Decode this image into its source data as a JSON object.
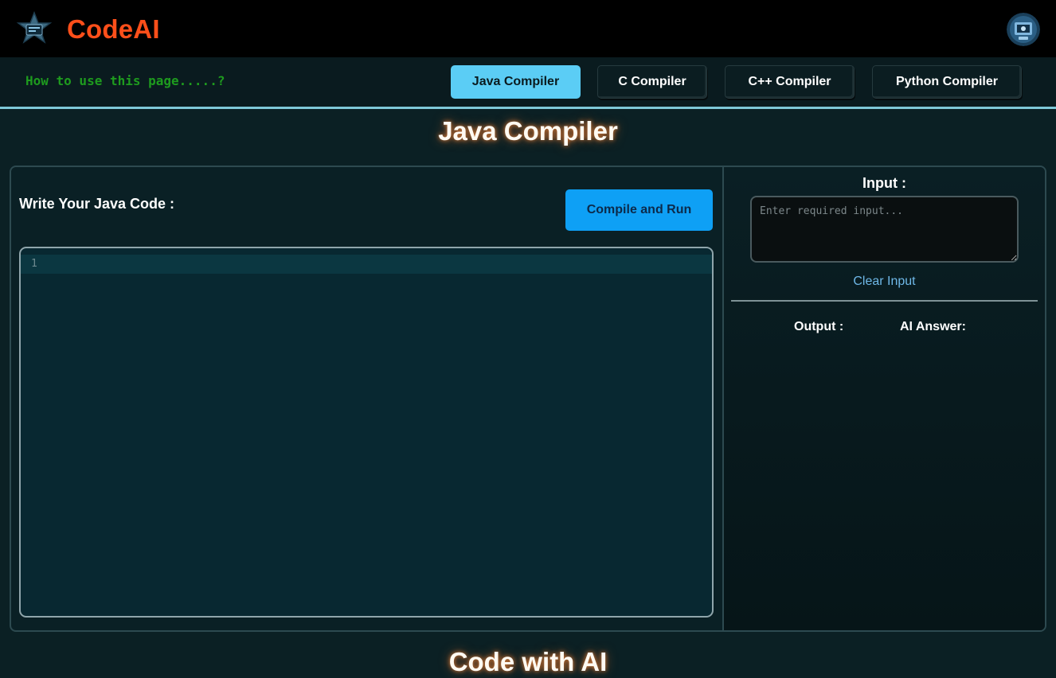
{
  "app": {
    "brand": "CodeAI",
    "brand_color": "#ff4f1a"
  },
  "header": {
    "logo_icon": "star-code-logo-icon",
    "avatar_icon": "user-avatar-icon"
  },
  "nav": {
    "help_link": "How to use this page.....?",
    "tabs": [
      {
        "label": "Java Compiler",
        "active": true
      },
      {
        "label": "C Compiler",
        "active": false
      },
      {
        "label": "C++ Compiler",
        "active": false
      },
      {
        "label": "Python Compiler",
        "active": false
      }
    ],
    "active_color": "#5bcdf5"
  },
  "main": {
    "title": "Java Compiler",
    "code_label": "Write Your Java Code :",
    "run_button": "Compile and Run",
    "run_button_color": "#0ea0f5",
    "editor": {
      "line_numbers": [
        "1"
      ],
      "code": ""
    }
  },
  "side": {
    "input_label": "Input :",
    "input_placeholder": "Enter required input...",
    "input_value": "",
    "clear_label": "Clear Input",
    "output_label": "Output :",
    "ai_label": "AI Answer:"
  },
  "footer": {
    "next_heading": "Code with AI"
  }
}
